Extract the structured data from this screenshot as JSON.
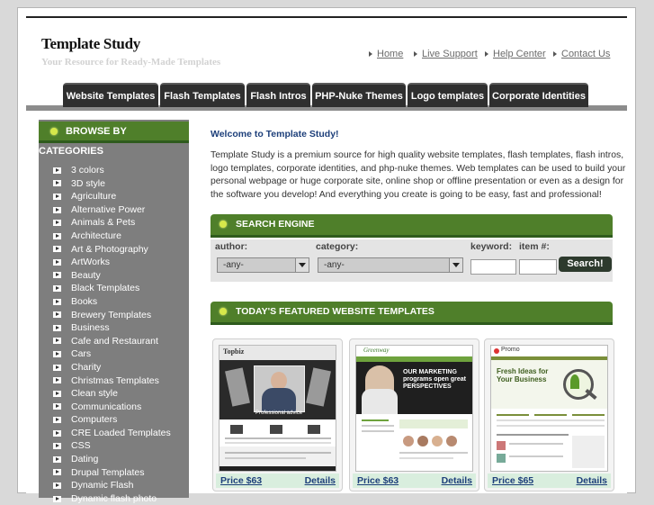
{
  "header": {
    "title": "Template Study",
    "subtitle": "Your Resource for Ready-Made Templates",
    "links": [
      "Home",
      "Live Support",
      "Help Center",
      "Contact Us"
    ]
  },
  "nav": {
    "tabs": [
      "Website Templates",
      "Flash Templates",
      "Flash Intros",
      "PHP-Nuke Themes",
      "Logo templates",
      "Corporate Identities"
    ]
  },
  "sidebar": {
    "heading": "BROWSE BY CATEGORIES",
    "categories": [
      "3 colors",
      "3D style",
      "Agriculture",
      "Alternative Power",
      "Animals & Pets",
      "Architecture",
      "Art & Photography",
      "ArtWorks",
      "Beauty",
      "Black Templates",
      "Books",
      "Brewery Templates",
      "Business",
      "Cafe and Restaurant",
      "Cars",
      "Charity",
      "Christmas Templates",
      "Clean style",
      "Communications",
      "Computers",
      "CRE Loaded Templates",
      "CSS",
      "Dating",
      "Drupal Templates",
      "Dynamic Flash",
      "Dynamic flash photo"
    ]
  },
  "main": {
    "welcome_title": "Welcome to Template Study!",
    "welcome_text": "Template Study is a premium source for high quality website templates, flash templates, flash intros, logo templates, corporate identities, and php-nuke themes. Web templates can be used to build your personal webpage or huge corporate site, online shop or offline presentation or even as a design for the software you develop! And everything you create is going to be easy, fast and professional!"
  },
  "search": {
    "heading": "SEARCH ENGINE",
    "author_label": "author:",
    "author_value": "-any-",
    "category_label": "category:",
    "category_value": "-any-",
    "keyword_label": "keyword:",
    "keyword_value": "",
    "item_label": "item #:",
    "item_value": "",
    "button": "Search!"
  },
  "featured": {
    "heading": "TODAY'S FEATURED WEBSITE TEMPLATES",
    "cards": [
      {
        "price": "Price $63",
        "details": "Details",
        "banner_text": "Professional advice",
        "logo": "Topbiz"
      },
      {
        "price": "Price $63",
        "details": "Details",
        "banner_text": "OUR MARKETING programs open great PERSPECTIVES",
        "logo": "Greenway"
      },
      {
        "price": "Price $65",
        "details": "Details",
        "banner_text": "Fresh Ideas for Your Business",
        "logo": "Promo"
      }
    ]
  },
  "colors": {
    "accent_green": "#4f7f2a",
    "tab_dark": "#2f2f2f",
    "sidebar_gray": "#7e7e7e",
    "link_blue": "#1d3f7a"
  }
}
